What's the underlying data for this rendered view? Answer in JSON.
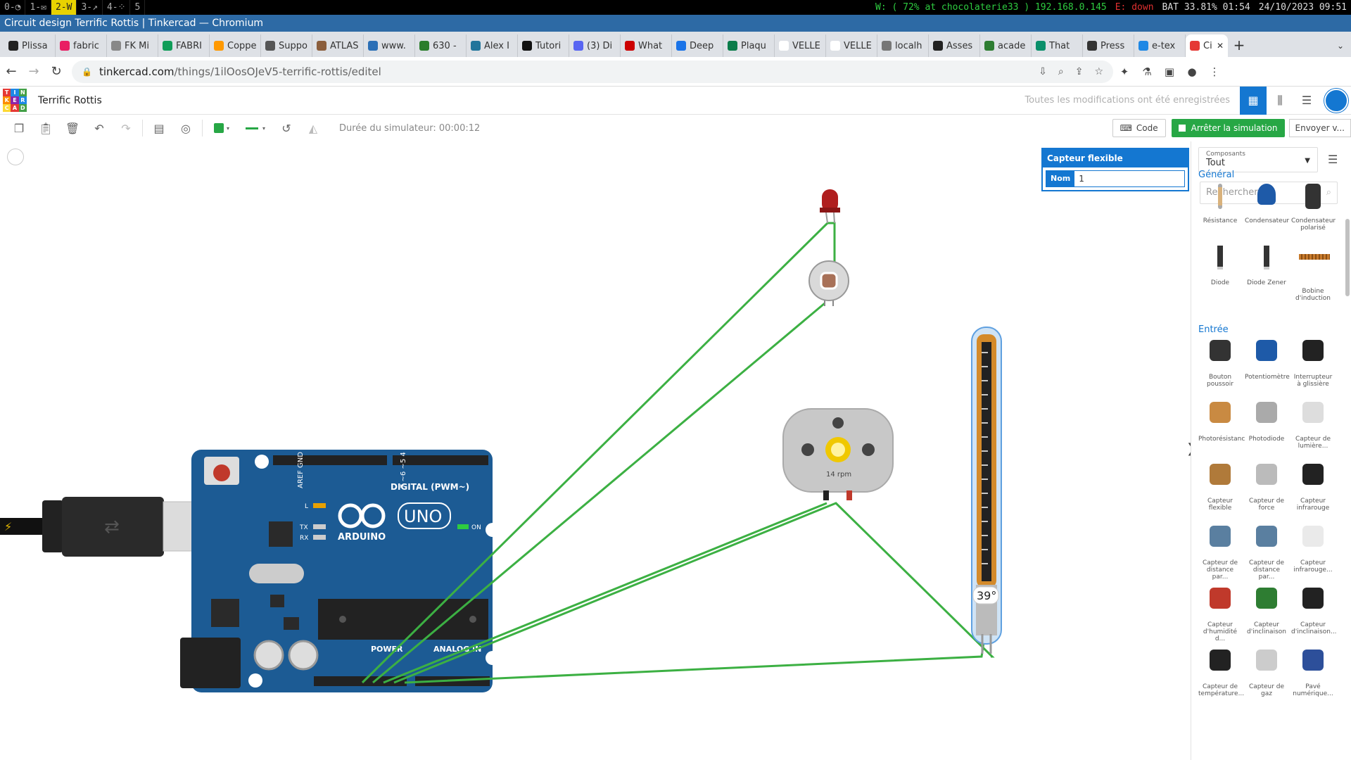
{
  "i3": {
    "workspaces": [
      "0-◔",
      "1-✉",
      "2-W",
      "3-↗",
      "4-⁘",
      "5"
    ],
    "active": 2,
    "wifi": "W: ( 72% at chocolaterie33 ) 192.168.0.145",
    "eth": "E: down",
    "bat": "BAT 33.81% 01:54",
    "datetime": "24/10/2023 09:51"
  },
  "window_title": "Circuit design Terrific Rottis | Tinkercad — Chromium",
  "tabs": [
    {
      "label": "Plissa",
      "color": "#222"
    },
    {
      "label": "fabric",
      "color": "#e91e63"
    },
    {
      "label": "FK Mi",
      "color": "#888"
    },
    {
      "label": "FABRI",
      "color": "#0f9d58"
    },
    {
      "label": "Coppe",
      "color": "#f90"
    },
    {
      "label": "Suppo",
      "color": "#555"
    },
    {
      "label": "ATLAS",
      "color": "#8b5e3c"
    },
    {
      "label": "www.",
      "color": "#2b6fb6"
    },
    {
      "label": "630 -",
      "color": "#2a7d2a"
    },
    {
      "label": "Alex I",
      "color": "#21759b"
    },
    {
      "label": "Tutori",
      "color": "#111"
    },
    {
      "label": "(3) Di",
      "color": "#5865f2"
    },
    {
      "label": "What",
      "color": "#c00"
    },
    {
      "label": "Deep",
      "color": "#1a73e8"
    },
    {
      "label": "Plaqu",
      "color": "#0a7c4a"
    },
    {
      "label": "VELLE",
      "color": "#fff"
    },
    {
      "label": "VELLE",
      "color": "#fff"
    },
    {
      "label": "localh",
      "color": "#777"
    },
    {
      "label": "Asses",
      "color": "#222"
    },
    {
      "label": "acade",
      "color": "#2e7d32"
    },
    {
      "label": "That",
      "color": "#0a8f6a"
    },
    {
      "label": "Press",
      "color": "#333"
    },
    {
      "label": "e-tex",
      "color": "#1e88e5"
    },
    {
      "label": "Ci",
      "color": "#e53935",
      "active": true
    }
  ],
  "new_tab": "+",
  "url": {
    "host": "tinkercad.com",
    "path": "/things/1ilOosOJeV5-terrific-rottis/editel"
  },
  "app": {
    "project_name": "Terrific Rottis",
    "saved_status": "Toutes les modifications ont été enregistrées",
    "sim_time": "Durée du simulateur: 00:00:12",
    "code_label": "Code",
    "stop_label": "Arrêter la simulation",
    "send_label": "Envoyer v...",
    "logo_letters": [
      "T",
      "I",
      "N",
      "K",
      "E",
      "R",
      "C",
      "A",
      "D"
    ]
  },
  "inspector": {
    "title": "Capteur flexible",
    "name_label": "Nom",
    "name_value": "1"
  },
  "circuit": {
    "motor_rpm": "14 rpm",
    "flex_angle": "39°",
    "arduino": {
      "digital_label": "DIGITAL (PWM~)",
      "power_label": "POWER",
      "analog_label": "ANALOG IN",
      "brand": "ARDUINO",
      "model": "UNO",
      "on_label": "ON",
      "tx": "TX",
      "rx": "RX",
      "l": "L"
    }
  },
  "panel": {
    "select_small": "Composants",
    "select_value": "Tout",
    "search_placeholder": "Rechercher",
    "sections": [
      {
        "title": "Général",
        "items": [
          "Résistance",
          "Condensateur",
          "Condensateur polarisé",
          "Diode",
          "Diode Zener",
          "Bobine d'induction"
        ]
      },
      {
        "title": "Entrée",
        "items": [
          "Bouton poussoir",
          "Potentiomètre",
          "Interrupteur à glissière",
          "Photorésistanc",
          "Photodiode",
          "Capteur de lumière...",
          "Capteur flexible",
          "Capteur de force",
          "Capteur infrarouge",
          "Capteur de distance par...",
          "Capteur de distance par...",
          "Capteur infrarouge...",
          "Capteur d'humidité d...",
          "Capteur d'inclinaison",
          "Capteur d'inclinaison...",
          "Capteur de température...",
          "Capteur de gaz",
          "Pavé numérique..."
        ]
      }
    ]
  },
  "colors": {
    "accent": "#1477d1",
    "wire": "#3cb043",
    "arduino": "#1c5b94",
    "stop": "#27a745"
  }
}
